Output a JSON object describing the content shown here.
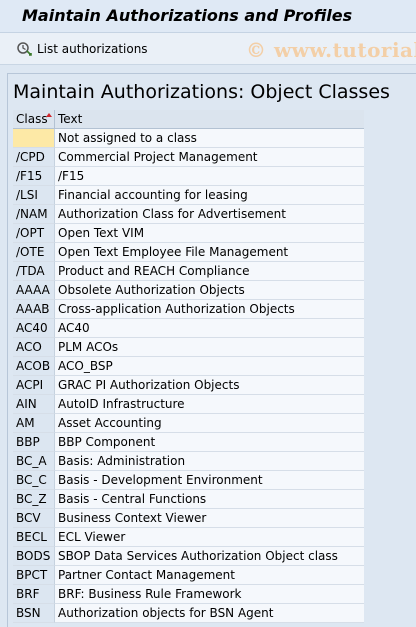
{
  "window": {
    "title": "Maintain Authorizations and Profiles"
  },
  "toolbar": {
    "list_button_label": "List authorizations",
    "list_button_icon": "list-authorizations-icon"
  },
  "watermark": "© www.tutorial",
  "list": {
    "title": "Maintain Authorizations: Object Classes",
    "columns": [
      "Class",
      "Text"
    ],
    "sort_column": "Class",
    "rows": [
      {
        "class": "",
        "text": "Not assigned to a class"
      },
      {
        "class": "/CPD",
        "text": "Commercial Project Management"
      },
      {
        "class": "/F15",
        "text": "/F15"
      },
      {
        "class": "/LSI",
        "text": "Financial accounting for leasing"
      },
      {
        "class": "/NAM",
        "text": "Authorization Class for Advertisement"
      },
      {
        "class": "/OPT",
        "text": "Open Text VIM"
      },
      {
        "class": "/OTE",
        "text": "Open Text Employee File Management"
      },
      {
        "class": "/TDA",
        "text": "Product and REACH Compliance"
      },
      {
        "class": "AAAA",
        "text": "Obsolete Authorization Objects"
      },
      {
        "class": "AAAB",
        "text": "Cross-application Authorization Objects"
      },
      {
        "class": "AC40",
        "text": "AC40"
      },
      {
        "class": "ACO",
        "text": "PLM ACOs"
      },
      {
        "class": "ACOB",
        "text": "ACO_BSP"
      },
      {
        "class": "ACPI",
        "text": "GRAC PI Authorization Objects"
      },
      {
        "class": "AIN",
        "text": "AutoID Infrastructure"
      },
      {
        "class": "AM",
        "text": "Asset Accounting"
      },
      {
        "class": "BBP",
        "text": "BBP Component"
      },
      {
        "class": "BC_A",
        "text": "Basis: Administration"
      },
      {
        "class": "BC_C",
        "text": "Basis - Development Environment"
      },
      {
        "class": "BC_Z",
        "text": "Basis - Central Functions"
      },
      {
        "class": "BCV",
        "text": "Business Context Viewer"
      },
      {
        "class": "BECL",
        "text": "ECL Viewer"
      },
      {
        "class": "BODS",
        "text": "SBOP Data Services Authorization Object class"
      },
      {
        "class": "BPCT",
        "text": "Partner Contact Management"
      },
      {
        "class": "BRF",
        "text": "BRF: Business Rule Framework"
      },
      {
        "class": "BSN",
        "text": "Authorization objects for BSN Agent"
      }
    ]
  },
  "colors": {
    "title_bar_bg": "#dfe9f5",
    "content_bg": "#dde7f2",
    "key_column_bg": "#dce6f1",
    "selected_key_bg": "#fde9a6",
    "sort_arrow": "#d0242b",
    "watermark": "#f3cfa7"
  }
}
